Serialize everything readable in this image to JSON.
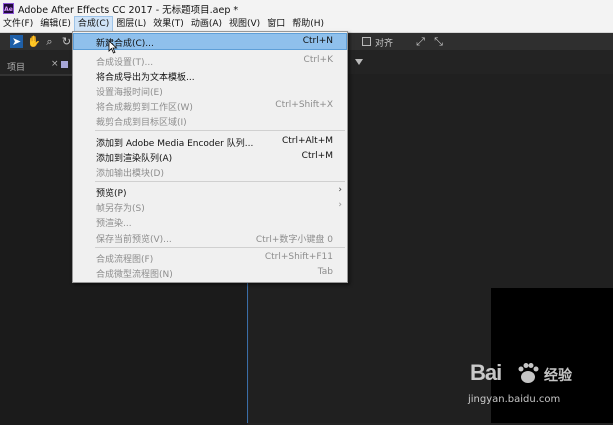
{
  "window": {
    "app_icon": "Ae",
    "title": "Adobe After Effects CC 2017 - 无标题项目.aep *"
  },
  "menubar": [
    "文件(F)",
    "编辑(E)",
    "合成(C)",
    "图层(L)",
    "效果(T)",
    "动画(A)",
    "视图(V)",
    "窗口",
    "帮助(H)"
  ],
  "active_menu_index": 2,
  "toolbar": {
    "snap_label": "对齐"
  },
  "panels": {
    "project_tab": "项目",
    "close_glyph": "×"
  },
  "dropdown": {
    "items": [
      {
        "label": "新建合成(C)...",
        "shortcut": "Ctrl+N",
        "disabled": false,
        "highlight": true
      },
      {
        "label": "合成设置(T)...",
        "shortcut": "Ctrl+K",
        "disabled": true
      },
      {
        "label": "将合成导出为文本模板...",
        "shortcut": "",
        "disabled": false
      },
      {
        "label": "设置海报时间(E)",
        "shortcut": "",
        "disabled": true
      },
      {
        "label": "将合成裁剪到工作区(W)",
        "shortcut": "Ctrl+Shift+X",
        "disabled": true
      },
      {
        "label": "裁剪合成到目标区域(I)",
        "shortcut": "",
        "disabled": true
      },
      {
        "label": "添加到 Adobe Media Encoder 队列...",
        "shortcut": "Ctrl+Alt+M",
        "disabled": false
      },
      {
        "label": "添加到渲染队列(A)",
        "shortcut": "Ctrl+M",
        "disabled": false
      },
      {
        "label": "添加输出模块(D)",
        "shortcut": "",
        "disabled": true
      },
      {
        "label": "预览(P)",
        "shortcut": "",
        "disabled": false,
        "submenu": true
      },
      {
        "label": "帧另存为(S)",
        "shortcut": "",
        "disabled": true,
        "submenu": true
      },
      {
        "label": "预渲染...",
        "shortcut": "",
        "disabled": true
      },
      {
        "label": "保存当前预览(V)...",
        "shortcut": "Ctrl+数字小键盘 0",
        "disabled": true
      },
      {
        "label": "合成流程图(F)",
        "shortcut": "Ctrl+Shift+F11",
        "disabled": true
      },
      {
        "label": "合成微型流程图(N)",
        "shortcut": "Tab",
        "disabled": true
      }
    ]
  },
  "watermark": {
    "logo": "Bai",
    "brand": "经验",
    "url": "jingyan.baidu.com"
  }
}
